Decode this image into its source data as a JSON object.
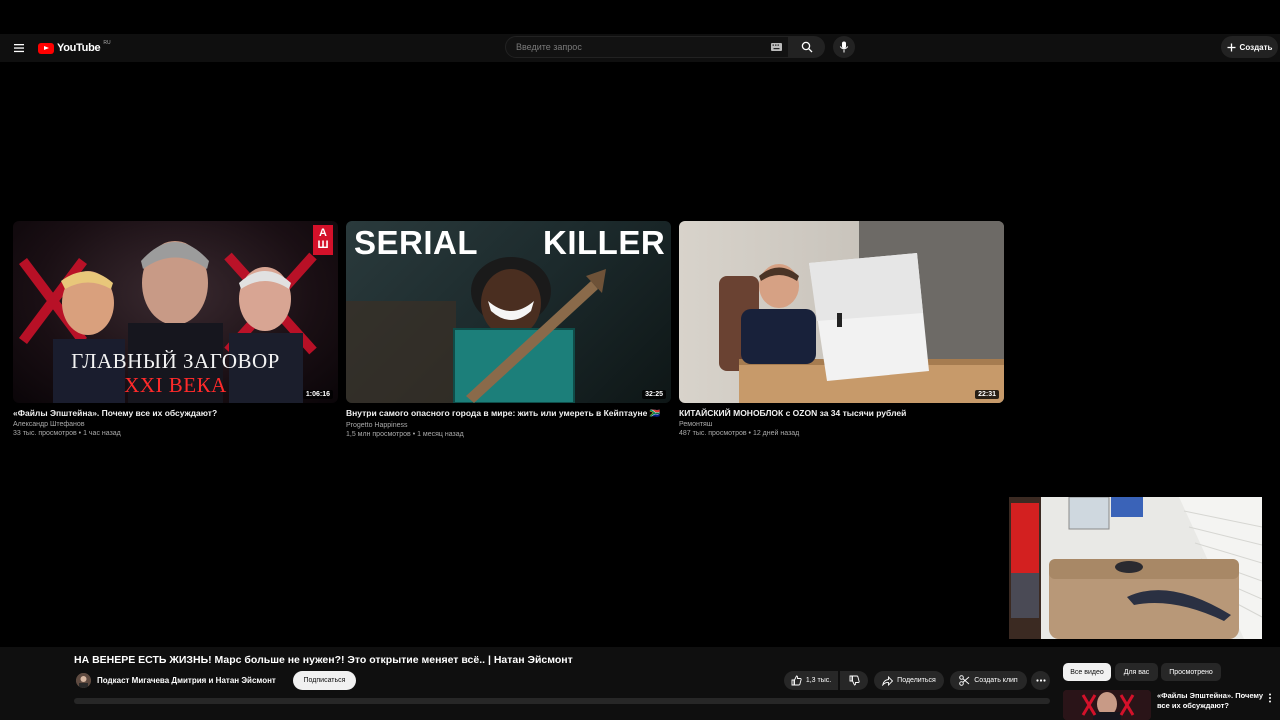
{
  "header": {
    "logo_text": "YouTube",
    "logo_region": "RU",
    "search_placeholder": "Введите запрос",
    "create_label": "Создать"
  },
  "videos": [
    {
      "title": "«Файлы Эпштейна». Почему все их обсуждают?",
      "channel": "Александр Штефанов",
      "views": "33 тыс. просмотров",
      "age": "1 час назад",
      "duration": "1:06:16",
      "thumb_text_line1": "ГЛАВНЫЙ ЗАГОВОР",
      "thumb_text_line2": "XXI ВЕКА",
      "thumb_badge": "АШ"
    },
    {
      "title": "Внутри самого опасного города в мире: жить или умереть в Кейптауне 🇿🇦",
      "channel": "Progetto Happiness",
      "views": "1,5 млн просмотров",
      "age": "1 месяц назад",
      "duration": "32:25",
      "thumb_text_left": "SERIAL",
      "thumb_text_right": "KILLER"
    },
    {
      "title": "КИТАЙСКИЙ МОНОБЛОК с OZON за 34 тысячи рублей",
      "channel": "Ремонтяш",
      "views": "487 тыс. просмотров",
      "age": "12 дней назад",
      "duration": "22:31"
    }
  ],
  "meta_separator": "•",
  "now_playing": {
    "title": "НА ВЕНЕРЕ ЕСТЬ ЖИЗНЬ! Марс больше не нужен?! Это открытие меняет всё.. | Натан Эйсмонт",
    "channel": "Подкаст Мигачева Дмитрия и Натан Эйсмонт",
    "subscribe_label": "Подписаться",
    "likes": "1,3 тыс.",
    "share_label": "Поделиться",
    "clip_label": "Создать клип"
  },
  "chips": [
    "Все видео",
    "Для вас",
    "Просмотрено"
  ],
  "recommended": {
    "title": "«Файлы Эпштейна». Почему все их обсуждают?"
  },
  "colors": {
    "background": "#000000",
    "surface": "#0f0f0f",
    "brand_red": "#ff0000",
    "pill": "#272727"
  }
}
